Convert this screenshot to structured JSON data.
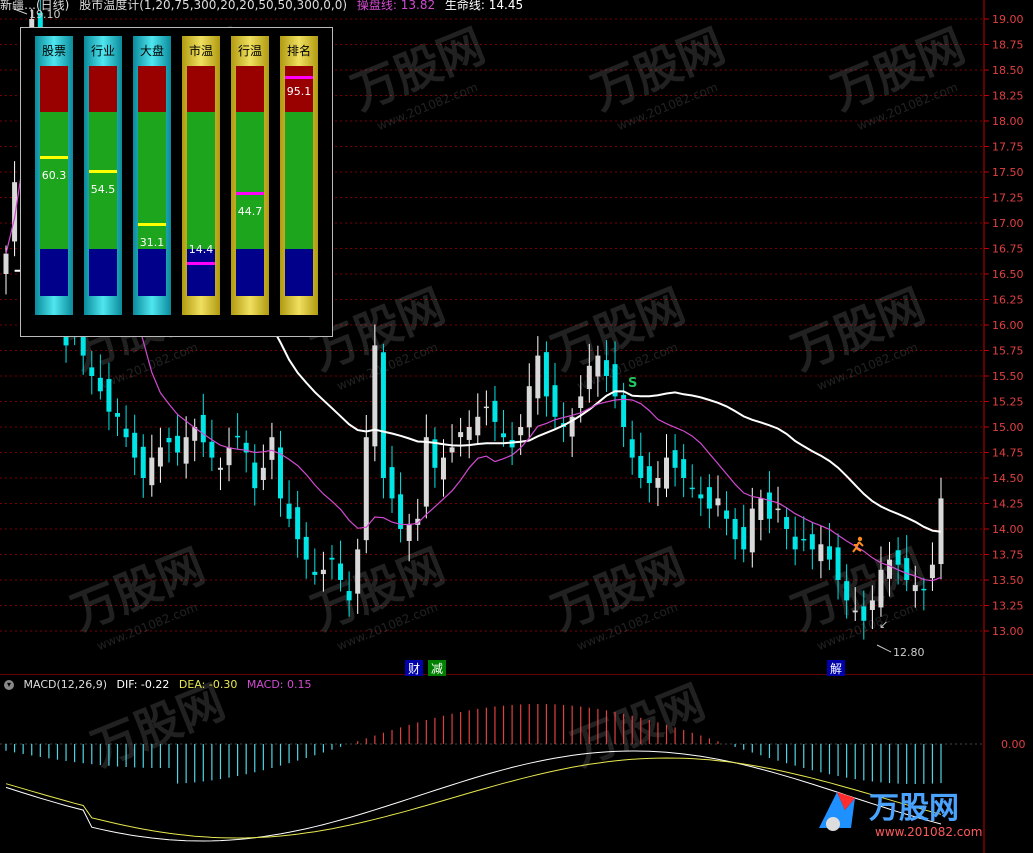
{
  "header": {
    "title_text": "新疆…(日线)",
    "indicator_text": "股市温度计(1,20,75,300,20,20,50,50,300,0,0)",
    "line1_label": "操盘线: 13.82",
    "line2_label": "生命线: 14.45"
  },
  "price_axis": {
    "labels": [
      "19.00",
      "18.75",
      "18.50",
      "18.25",
      "18.00",
      "17.75",
      "17.50",
      "17.25",
      "17.00",
      "16.75",
      "16.50",
      "16.25",
      "16.00",
      "15.75",
      "15.50",
      "15.25",
      "15.00",
      "14.75",
      "14.50",
      "14.25",
      "14.00",
      "13.75",
      "13.50",
      "13.25",
      "13.00"
    ],
    "high_marker": "19.10",
    "low_marker": "12.80"
  },
  "gauges": [
    {
      "label": "股票",
      "value_text": "60.3",
      "value": 60.3,
      "style": "cyan",
      "marker": "#ffff00"
    },
    {
      "label": "行业",
      "value_text": "54.5",
      "value": 54.5,
      "style": "cyan",
      "marker": "#ffff00"
    },
    {
      "label": "大盘",
      "value_text": "31.1",
      "value": 31.1,
      "style": "cyan",
      "marker": "#ffff00"
    },
    {
      "label": "市温",
      "value_text": "14.4",
      "value": 14.4,
      "style": "yellow",
      "marker": "#ff00ff"
    },
    {
      "label": "行温",
      "value_text": "44.7",
      "value": 44.7,
      "style": "yellow",
      "marker": "#ff00ff"
    },
    {
      "label": "排名",
      "value_text": "95.1",
      "value": 95.1,
      "style": "yellow",
      "marker": "#ff00ff"
    }
  ],
  "signals": {
    "sell_label": "S",
    "events": [
      {
        "text": "财",
        "color": "#ffffff",
        "bg": "#0000aa"
      },
      {
        "text": "减",
        "color": "#ffffff",
        "bg": "#008000"
      },
      {
        "text": "解",
        "color": "#ffffff",
        "bg": "#0000aa"
      }
    ]
  },
  "macd": {
    "toggle_icon": "chevron-down-icon",
    "title": "MACD(12,26,9)",
    "dif": "DIF: -0.22",
    "dea": "DEA: -0.30",
    "macd": "MACD: 0.15",
    "zero_label": "0.00"
  },
  "watermark": {
    "brand": "万股网",
    "url": "www.201082.com"
  },
  "colors": {
    "up": "#ffffff",
    "down": "#00e5e5",
    "ma_white": "#ffffff",
    "ma_magenta": "#d14bd1",
    "axis": "#c00000",
    "dif": "#ffffff",
    "dea": "#e8e850"
  }
}
